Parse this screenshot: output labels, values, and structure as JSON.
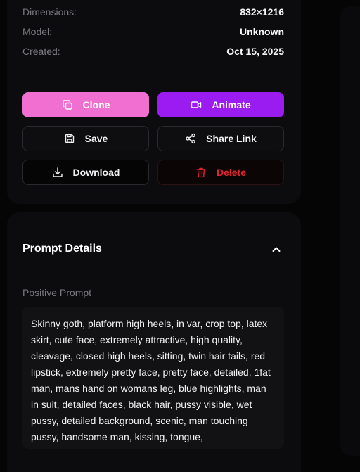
{
  "meta": {
    "dimensions_label": "Dimensions:",
    "dimensions_value": "832×1216",
    "model_label": "Model:",
    "model_value": "Unknown",
    "created_label": "Created:",
    "created_value": "Oct 15, 2025"
  },
  "actions": {
    "clone": "Clone",
    "animate": "Animate",
    "save": "Save",
    "share": "Share Link",
    "download": "Download",
    "delete": "Delete"
  },
  "prompt_details": {
    "title": "Prompt Details",
    "positive_label": "Positive Prompt",
    "positive_text": "Skinny goth, platform high heels, in var, crop top, latex skirt, cute face, extremely attractive, high quality, cleavage, closed high heels, sitting, twin hair tails, red lipstick, extremely pretty face, pretty face, detailed, 1fat man, mans hand on womans leg, blue highlights, man in suit, detailed faces, black hair, pussy visible, wet pussy, detailed background, scenic, man touching pussy, handsome man, kissing, tongue,"
  },
  "colors": {
    "clone_bg": "#f06fd0",
    "animate_bg": "#9a1cf0",
    "delete_text": "#e0262d"
  },
  "icons": {
    "clone": "copy-icon",
    "animate": "video-camera-icon",
    "save": "floppy-disk-icon",
    "share": "share-nodes-icon",
    "download": "download-icon",
    "delete": "trash-icon",
    "collapse": "chevron-up-icon"
  }
}
